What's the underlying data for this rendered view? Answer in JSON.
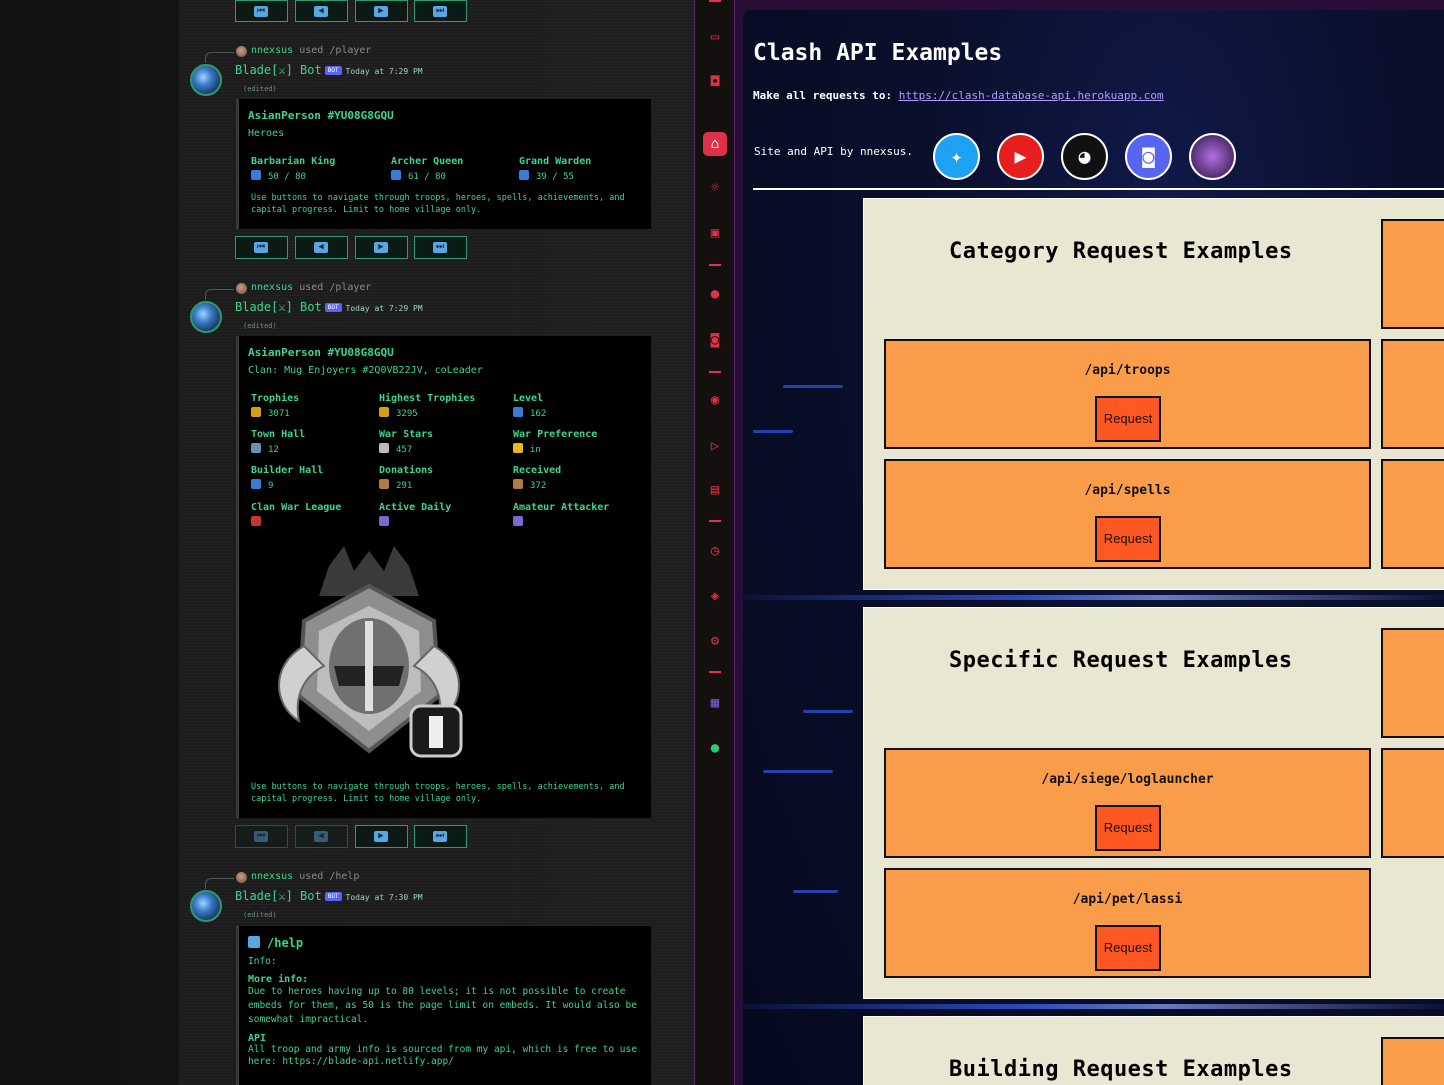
{
  "discord": {
    "messages": [
      {
        "reply_user": "nnexsus",
        "reply_verb": "used",
        "reply_cmd": "/player",
        "author": "Blade[⚔] Bot",
        "bot_tag": "BOT",
        "time": "Today at 7:29 PM",
        "edited": "(edited)",
        "embed_title": "AsianPerson #YU08G8GQU",
        "embed_subtitle": "Heroes",
        "fields": [
          {
            "name": "Barbarian King",
            "value": "50 / 80",
            "icon": "shield-icon"
          },
          {
            "name": "Archer Queen",
            "value": "61 / 80",
            "icon": "shield-icon"
          },
          {
            "name": "Grand Warden",
            "value": "39 / 55",
            "icon": "shield-icon"
          }
        ],
        "footer": "Use buttons to navigate through troops, heroes, spells, achievements, and capital progress. Limit to home village only."
      },
      {
        "reply_user": "nnexsus",
        "reply_verb": "used",
        "reply_cmd": "/player",
        "author": "Blade[⚔] Bot",
        "bot_tag": "BOT",
        "time": "Today at 7:29 PM",
        "edited": "(edited)",
        "embed_title": "AsianPerson #YU08G8GQU",
        "embed_subtitle": "Clan: Mug Enjoyers #2Q0VB22JV, coLeader",
        "fields": [
          {
            "name": "Trophies",
            "value": "3071",
            "icon": "trophy-icon"
          },
          {
            "name": "Highest Trophies",
            "value": "3295",
            "icon": "trophy-icon"
          },
          {
            "name": "Level",
            "value": "162",
            "icon": "shield-icon"
          },
          {
            "name": "Town Hall",
            "value": "12",
            "icon": "town-hall-icon"
          },
          {
            "name": "War Stars",
            "value": "457",
            "icon": "war-star-icon"
          },
          {
            "name": "War Preference",
            "value": "in",
            "icon": "crown-icon"
          },
          {
            "name": "Builder Hall",
            "value": "9",
            "icon": "shield-icon"
          },
          {
            "name": "Donations",
            "value": "291",
            "icon": "troop-icon"
          },
          {
            "name": "Received",
            "value": "372",
            "icon": "troop-icon"
          },
          {
            "name": "Clan War League",
            "value": "",
            "icon": "cwl-icon"
          },
          {
            "name": "Active Daily",
            "value": "",
            "icon": "label-icon"
          },
          {
            "name": "Amateur Attacker",
            "value": "",
            "icon": "label-icon"
          }
        ],
        "footer": "Use buttons to navigate through troops, heroes, spells, achievements, and capital progress. Limit to home village only."
      },
      {
        "reply_user": "nnexsus",
        "reply_verb": "used",
        "reply_cmd": "/help",
        "author": "Blade[⚔] Bot",
        "bot_tag": "BOT",
        "time": "Today at 7:30 PM",
        "edited": "(edited)",
        "embed_title": "/help",
        "info_label": "Info:",
        "more_info_label": "More info:",
        "more_info_text": "Due to heroes having up to 80 levels; it is not possible to create embeds for them, as 50 is the page limit on embeds. It would also be somewhat impractical.",
        "api_label": "API",
        "api_text": "All troop and army info is sourced from my api, which is free to use here: https://blade-api.netlify.app/"
      }
    ],
    "nav_buttons": [
      "first-page-icon",
      "prev-page-icon",
      "next-page-icon",
      "last-page-icon"
    ]
  },
  "sidebar": {
    "icons": [
      "bag-icon",
      "twitch-icon",
      "home-icon",
      "sun-icon",
      "video-icon",
      "twitter-icon",
      "discord-icon",
      "play-icon",
      "send-icon",
      "wallet-icon",
      "clock-icon",
      "cube-icon",
      "gear-icon",
      "app-icon",
      "extension-icon"
    ]
  },
  "site": {
    "title": "Clash API Examples",
    "requests_label": "Make all requests to:",
    "requests_url": "https://clash-database-api.herokuapp.com",
    "byline": "Site and API by nnexsus.",
    "socials": [
      "twitter-icon",
      "youtube-icon",
      "github-icon",
      "discord-icon",
      "profile-icon"
    ],
    "sections": [
      {
        "title": "Category Request Examples",
        "cards": [
          {
            "path": "/api/troops",
            "button": "Request"
          },
          {
            "path": "/api/spells",
            "button": "Request"
          }
        ]
      },
      {
        "title": "Specific Request Examples",
        "cards": [
          {
            "path": "/api/siege/loglauncher",
            "button": "Request"
          },
          {
            "path": "/api/pet/lassi",
            "button": "Request"
          }
        ]
      },
      {
        "title": "Building Request Examples",
        "cards": []
      }
    ]
  },
  "colors": {
    "discord_green": "#3fd48c",
    "accent_red": "#e0304a",
    "card_orange": "#fa9d4b",
    "button_orange": "#ff5722",
    "panel_cream": "#e9e7d1"
  }
}
